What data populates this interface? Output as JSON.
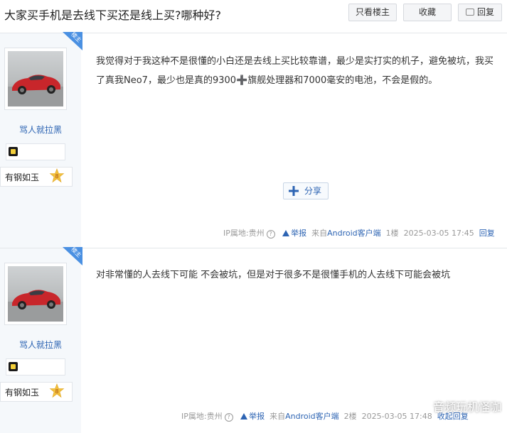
{
  "thread": {
    "title": "大家买手机是去线下买还是线上买?哪种好?",
    "buttons": {
      "only_op": "只看楼主",
      "favorite": "收藏",
      "reply": "回复"
    }
  },
  "posts": [
    {
      "ribbon": "楼主",
      "user": {
        "name": "骂人就拉黑",
        "level_name": "有钢如玉",
        "level_num": "8"
      },
      "content": "我觉得对于我这种不是很懂的小白还是去线上买比较靠谱，最少是实打实的机子，避免被坑，我买了真我Neo7，最少也是真的9300➕旗舰处理器和7000毫安的电池，不会是假的。",
      "share": "分享",
      "meta": {
        "ip": "IP属地:贵州",
        "report": "举报",
        "source": "来自Android客户端",
        "floor": "1楼",
        "time": "2025-03-05 17:45",
        "reply": "回复"
      }
    },
    {
      "ribbon": "楼主",
      "user": {
        "name": "骂人就拉黑",
        "level_name": "有钢如玉",
        "level_num": "8"
      },
      "content": "对非常懂的人去线下可能 不会被坑，但是对于很多不是很懂手机的人去线下可能会被坑",
      "meta": {
        "ip": "IP属地:贵州",
        "report": "举报",
        "source": "来自Android客户端",
        "floor": "2楼",
        "time": "2025-03-05 17:48",
        "reply": "收起回复"
      }
    }
  ],
  "watermark": "音频玩机怪咖",
  "colors": {
    "link": "#2d64b3",
    "ribbon": "#4a90e2",
    "sidebar": "#f5f8fb"
  }
}
